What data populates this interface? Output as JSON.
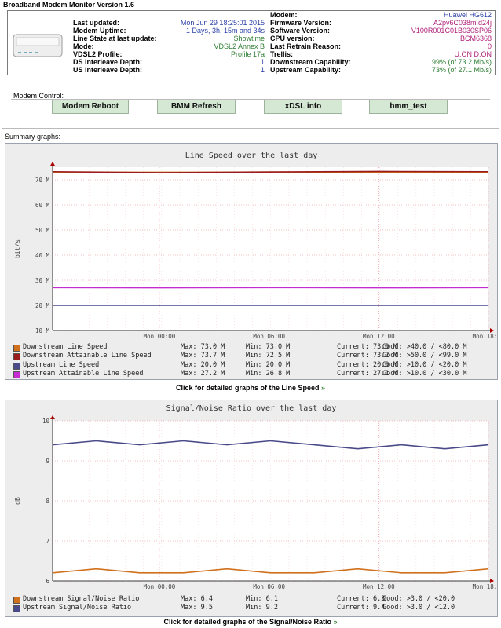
{
  "app_title": "Broadband Modem Monitor Version 1.6",
  "status_left": [
    {
      "label": "Last updated:",
      "value": "Mon Jun 29 18:25:01 2015",
      "color": "blue"
    },
    {
      "label": "Modem Uptime:",
      "value": "1 Days, 3h, 15m and 34s",
      "color": "blue"
    },
    {
      "label": "Line State at last update:",
      "value": "Showtime",
      "color": "green"
    },
    {
      "label": "Mode:",
      "value": "VDSL2 Annex B",
      "color": "green"
    },
    {
      "label": "VDSL2 Profile:",
      "value": "Profile 17a",
      "color": "green"
    },
    {
      "label": "DS Interleave Depth:",
      "value": "1",
      "color": "blue"
    },
    {
      "label": "US Interleave Depth:",
      "value": "1",
      "color": "blue"
    }
  ],
  "status_right": [
    {
      "label": "Modem:",
      "value": "Huawei HG612",
      "color": "blue"
    },
    {
      "label": "Firmware Version:",
      "value": "A2pv6C038m.d24j",
      "color": "pink"
    },
    {
      "label": "Software Version:",
      "value": "V100R001C01B030SP06",
      "color": "pink"
    },
    {
      "label": "CPU version:",
      "value": "BCM6368",
      "color": "pink"
    },
    {
      "label": "Last Retrain Reason:",
      "value": "0",
      "color": "pink"
    },
    {
      "label": "Trellis:",
      "value": "U:ON D:ON",
      "color": "pink"
    },
    {
      "label": "Downstream Capability:",
      "value": "99% (of 73.2 Mb/s)",
      "color": "green"
    },
    {
      "label": "Upstream Capability:",
      "value": "73% (of 27.1 Mb/s)",
      "color": "green"
    }
  ],
  "modem_control": {
    "title": "Modem Control:",
    "buttons": [
      "Modem Reboot",
      "BMM Refresh",
      "xDSL info",
      "bmm_test"
    ]
  },
  "summary_title": "Summary graphs:",
  "graphs": {
    "speed": {
      "title": "Line Speed over the last day",
      "link_text": "Click for detailed graphs of the Line Speed",
      "legend": [
        {
          "name": "Downstream Line Speed",
          "max": "Max: 73.0 M",
          "min": "Min: 73.0 M",
          "current": "Current: 73.0 M",
          "good": "Good: >40.0 / <80.0 M",
          "color": "#d0701c"
        },
        {
          "name": "Downstream Attainable Line Speed",
          "max": "Max: 73.7 M",
          "min": "Min: 72.5 M",
          "current": "Current: 73.2 M",
          "good": "Good: >50.0 / <99.0 M",
          "color": "#9b1c1c"
        },
        {
          "name": "Upstream Line Speed",
          "max": "Max: 20.0 M",
          "min": "Min: 20.0 M",
          "current": "Current: 20.0 M",
          "good": "Good: >10.0 / <20.0 M",
          "color": "#4a4a8a"
        },
        {
          "name": "Upstream Attainable Line Speed",
          "max": "Max: 27.2 M",
          "min": "Min: 26.8 M",
          "current": "Current: 27.1 M",
          "good": "Good: >10.0 / <30.0 M",
          "color": "#c52bd1"
        }
      ]
    },
    "snr": {
      "title": "Signal/Noise Ratio over the last day",
      "link_text": "Click for detailed graphs of the Signal/Noise Ratio",
      "legend": [
        {
          "name": "Downstream Signal/Noise Ratio",
          "max": "Max: 6.4",
          "min": "Min: 6.1",
          "current": "Current: 6.3",
          "good": "Good: >3.0 / <20.0",
          "color": "#d0701c"
        },
        {
          "name": "Upstream Signal/Noise Ratio",
          "max": "Max: 9.5",
          "min": "Min: 9.2",
          "current": "Current: 9.4",
          "good": "Good: >3.0 / <12.0",
          "color": "#4a4a8a"
        }
      ]
    }
  },
  "chart_data": [
    {
      "type": "line",
      "title": "Line Speed over the last day",
      "ylabel": "bit/s",
      "ylim": [
        10,
        75
      ],
      "yticks": [
        "10 M",
        "20 M",
        "30 M",
        "40 M",
        "50 M",
        "60 M",
        "70 M"
      ],
      "xticks": [
        "Mon 00:00",
        "Mon 06:00",
        "Mon 12:00",
        "Mon 18:00"
      ],
      "series": [
        {
          "name": "Downstream Line Speed",
          "values": [
            73.0,
            73.0,
            73.0,
            73.0,
            73.0
          ],
          "color": "#d0701c"
        },
        {
          "name": "Downstream Attainable Line Speed",
          "values": [
            73.2,
            72.8,
            73.1,
            73.3,
            73.2
          ],
          "color": "#9b1c1c"
        },
        {
          "name": "Upstream Line Speed",
          "values": [
            20.0,
            20.0,
            20.0,
            20.0,
            20.0
          ],
          "color": "#4a4a8a"
        },
        {
          "name": "Upstream Attainable Line Speed",
          "values": [
            27.1,
            27.0,
            27.1,
            27.0,
            27.1
          ],
          "color": "#c52bd1"
        }
      ]
    },
    {
      "type": "line",
      "title": "Signal/Noise Ratio over the last day",
      "ylabel": "dB",
      "ylim": [
        6,
        10
      ],
      "yticks": [
        "6",
        "7",
        "8",
        "9",
        "10"
      ],
      "xticks": [
        "Mon 00:00",
        "Mon 06:00",
        "Mon 12:00",
        "Mon 18:00"
      ],
      "series": [
        {
          "name": "Downstream Signal/Noise Ratio",
          "values": [
            6.2,
            6.3,
            6.2,
            6.2,
            6.3,
            6.2,
            6.2,
            6.3,
            6.2,
            6.2,
            6.3
          ],
          "color": "#d0701c"
        },
        {
          "name": "Upstream Signal/Noise Ratio",
          "values": [
            9.4,
            9.5,
            9.4,
            9.5,
            9.4,
            9.5,
            9.4,
            9.3,
            9.4,
            9.3,
            9.4
          ],
          "color": "#4a4a8a"
        }
      ]
    }
  ]
}
